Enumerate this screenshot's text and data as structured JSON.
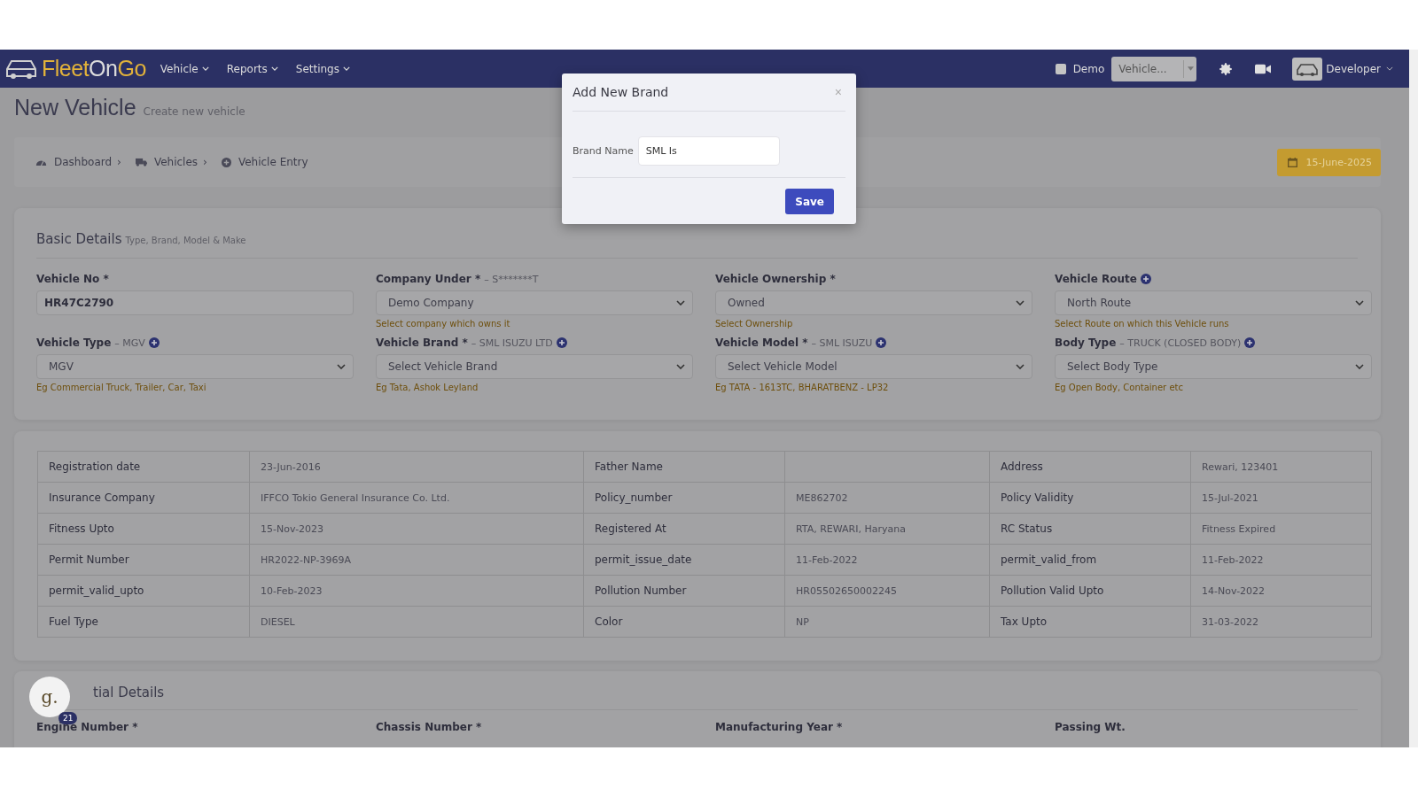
{
  "navbar": {
    "logo_parts": [
      {
        "text": "Fleet",
        "color": "#e2b23a"
      },
      {
        "text": "On",
        "color": "#dcdcdc"
      },
      {
        "text": "Go",
        "color": "#e2b23a"
      }
    ],
    "menus": [
      "Vehicle",
      "Reports",
      "Settings"
    ],
    "demo": {
      "label": "Demo",
      "checked": false
    },
    "vehicle_select": {
      "value": "Vehicle..."
    },
    "user": "Developer"
  },
  "page": {
    "title": "New Vehicle",
    "subtitle": "Create new vehicle"
  },
  "breadcrumbs": {
    "separator": "›",
    "items": [
      {
        "label": "Dashboard"
      },
      {
        "label": "Vehicles"
      },
      {
        "label": "Vehicle Entry"
      }
    ]
  },
  "date_button": "15-June-2025",
  "basic_details": {
    "title": "Basic Details",
    "subtitle": "Type, Brand, Model & Make",
    "fields": [
      {
        "label": "Vehicle No *",
        "kind": "input",
        "value": "HR47C2790",
        "add": false
      },
      {
        "label": "Company Under *",
        "note": "– S*******T",
        "kind": "select",
        "value": "Demo Company",
        "hint": "Select company which owns it",
        "add": false
      },
      {
        "label": "Vehicle Ownership *",
        "kind": "select",
        "value": "Owned",
        "hint": "Select Ownership",
        "add": false
      },
      {
        "label": "Vehicle Route",
        "kind": "select",
        "value": "North Route",
        "hint": "Select Route on which this Vehicle runs",
        "add": true
      },
      {
        "label": "Vehicle Type",
        "note": "– MGV",
        "kind": "select",
        "value": "MGV",
        "hint": "Eg Commercial Truck, Trailer, Car, Taxi",
        "add": true
      },
      {
        "label": "Vehicle Brand *",
        "note": "– SML ISUZU LTD",
        "kind": "select",
        "value": "Select Vehicle Brand",
        "hint": "Eg Tata, Ashok Leyland",
        "add": true
      },
      {
        "label": "Vehicle Model *",
        "note": "– SML ISUZU",
        "kind": "select",
        "value": "Select Vehicle Model",
        "hint": "Eg TATA - 1613TC, BHARATBENZ - LP32",
        "add": true
      },
      {
        "label": "Body Type",
        "note": "– TRUCK (CLOSED BODY)",
        "kind": "select",
        "value": "Select Body Type",
        "hint": "Eg Open Body, Container etc",
        "add": true
      }
    ]
  },
  "details_table": {
    "rows": [
      [
        "Registration date",
        "23-Jun-2016",
        "Father Name",
        "",
        "Address",
        "Rewari, 123401"
      ],
      [
        "Insurance Company",
        "IFFCO Tokio General Insurance Co. Ltd.",
        "Policy_number",
        "ME862702",
        "Policy Validity",
        "15-Jul-2021"
      ],
      [
        "Fitness Upto",
        "15-Nov-2023",
        "Registered At",
        "RTA, REWARI, Haryana",
        "RC Status",
        "Fitness Expired"
      ],
      [
        "Permit Number",
        "HR2022-NP-3969A",
        "permit_issue_date",
        "11-Feb-2022",
        "permit_valid_from",
        "11-Feb-2022"
      ],
      [
        "permit_valid_upto",
        "10-Feb-2023",
        "Pollution Number",
        "HR05502650002245",
        "Pollution Valid Upto",
        "14-Nov-2022"
      ],
      [
        "Fuel Type",
        "DIESEL",
        "Color",
        "NP",
        "Tax Upto",
        "31-03-2022"
      ]
    ]
  },
  "next_section": {
    "title": "tial Details",
    "labels": [
      "Engine Number *",
      "Chassis Number *",
      "Manufacturing Year *",
      "Passing Wt."
    ]
  },
  "chat_bubble": {
    "letter": "g.",
    "badge": "21"
  },
  "modal": {
    "title": "Add New Brand",
    "close": "×",
    "field_label": "Brand Name",
    "field_value": "SML Is",
    "save": "Save"
  }
}
